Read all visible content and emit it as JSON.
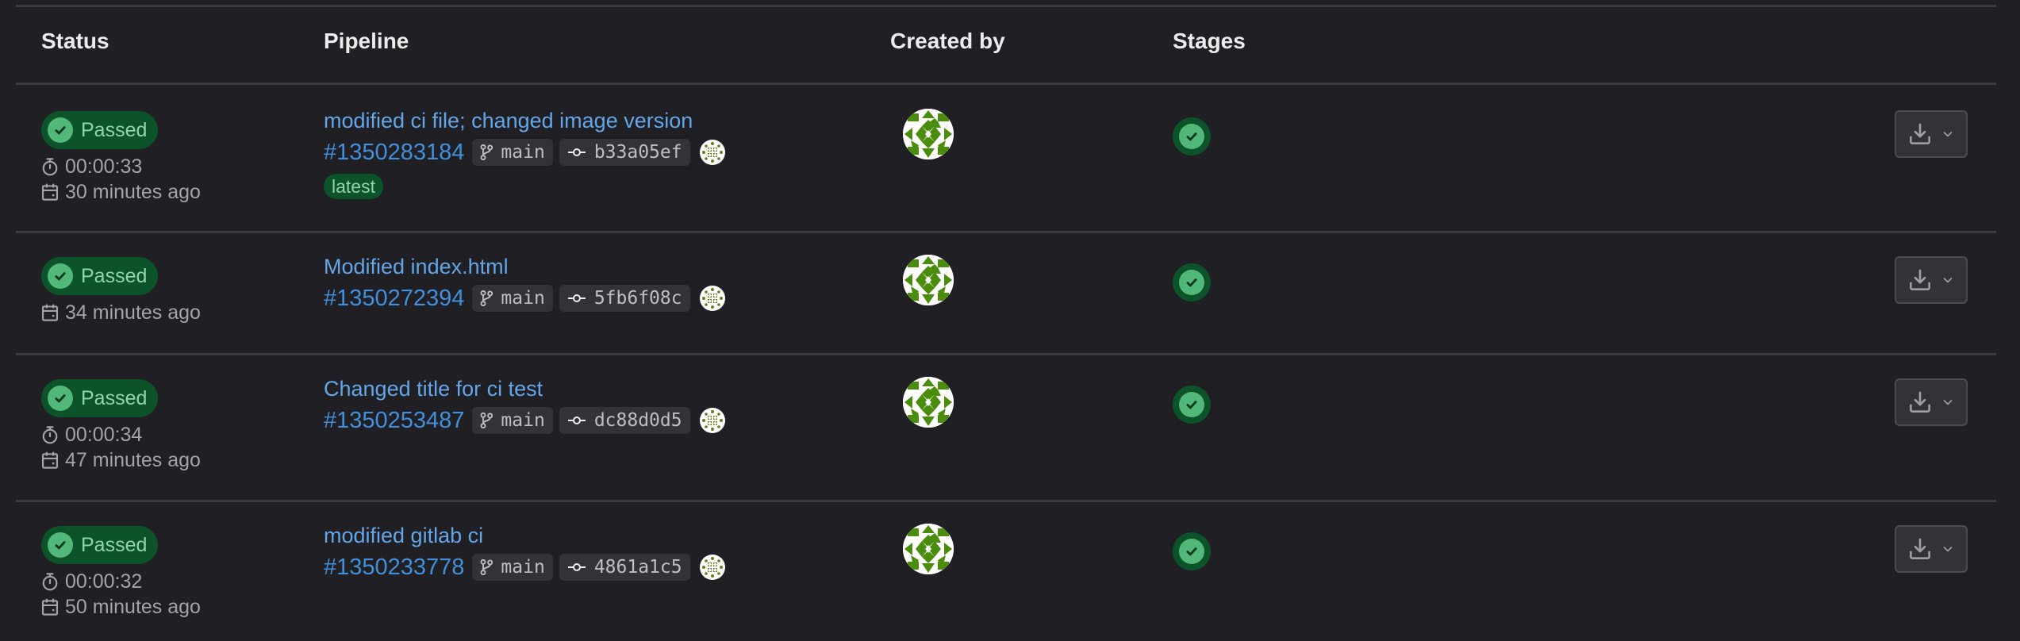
{
  "table": {
    "headers": {
      "status": "Status",
      "pipeline": "Pipeline",
      "created_by": "Created by",
      "stages": "Stages"
    },
    "rows": [
      {
        "status": "Passed",
        "duration": "00:00:33",
        "finished": "30 minutes ago",
        "title": "modified ci file; changed image version",
        "pipeline_id": "#1350283184",
        "branch": "main",
        "commit": "b33a05ef",
        "tag": "latest",
        "stage_status": "passed"
      },
      {
        "status": "Passed",
        "duration": null,
        "finished": "34 minutes ago",
        "title": "Modified index.html",
        "pipeline_id": "#1350272394",
        "branch": "main",
        "commit": "5fb6f08c",
        "tag": null,
        "stage_status": "passed"
      },
      {
        "status": "Passed",
        "duration": "00:00:34",
        "finished": "47 minutes ago",
        "title": "Changed title for ci test",
        "pipeline_id": "#1350253487",
        "branch": "main",
        "commit": "dc88d0d5",
        "tag": null,
        "stage_status": "passed"
      },
      {
        "status": "Passed",
        "duration": "00:00:32",
        "finished": "50 minutes ago",
        "title": "modified gitlab ci",
        "pipeline_id": "#1350233778",
        "branch": "main",
        "commit": "4861a1c5",
        "tag": null,
        "stage_status": "passed"
      }
    ]
  },
  "icons": {
    "status": "check-circle-icon",
    "duration": "timer-icon",
    "finished": "calendar-icon",
    "branch": "branch-icon",
    "commit": "commit-icon",
    "actions": "download-icon",
    "dropdown": "chevron-down-icon"
  },
  "colors": {
    "background": "#1f1f24",
    "success_bg": "#0d532a",
    "success_fg": "#91d4a8",
    "success_icon": "#52b87a",
    "link": "#63a6e9",
    "avatar_green": "#4a8c0c"
  }
}
